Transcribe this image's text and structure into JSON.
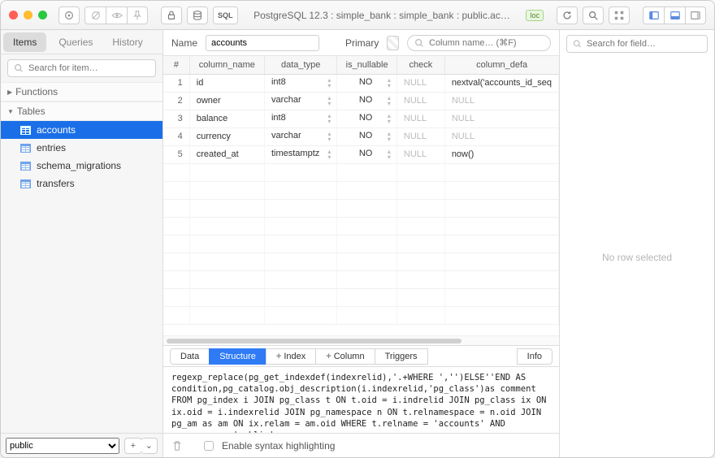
{
  "toolbar": {
    "sql_label": "SQL",
    "title": "PostgreSQL 12.3 : simple_bank : simple_bank : public.ac…",
    "loc_badge": "loc"
  },
  "sidebar": {
    "tabs": [
      "Items",
      "Queries",
      "History"
    ],
    "active_tab": 0,
    "search_placeholder": "Search for item…",
    "groups": [
      {
        "label": "Functions",
        "expanded": false
      },
      {
        "label": "Tables",
        "expanded": true
      }
    ],
    "tables": [
      "accounts",
      "entries",
      "schema_migrations",
      "transfers"
    ],
    "selected_table": "accounts",
    "schema_selector": "public"
  },
  "main": {
    "name_label": "Name",
    "name_value": "accounts",
    "primary_label": "Primary",
    "column_search_placeholder": "Column name… (⌘F)",
    "headers": [
      "#",
      "column_name",
      "data_type",
      "is_nullable",
      "check",
      "column_defa"
    ],
    "rows": [
      {
        "n": 1,
        "name": "id",
        "type": "int8",
        "nullable": "NO",
        "check": "NULL",
        "default": "nextval('accounts_id_seq"
      },
      {
        "n": 2,
        "name": "owner",
        "type": "varchar",
        "nullable": "NO",
        "check": "NULL",
        "default": "NULL"
      },
      {
        "n": 3,
        "name": "balance",
        "type": "int8",
        "nullable": "NO",
        "check": "NULL",
        "default": "NULL"
      },
      {
        "n": 4,
        "name": "currency",
        "type": "varchar",
        "nullable": "NO",
        "check": "NULL",
        "default": "NULL"
      },
      {
        "n": 5,
        "name": "created_at",
        "type": "timestamptz",
        "nullable": "NO",
        "check": "NULL",
        "default": "now()"
      }
    ],
    "tabs": [
      "Data",
      "Structure",
      "Index",
      "Column",
      "Triggers",
      "Info"
    ],
    "tab_plus": [
      false,
      false,
      true,
      true,
      false,
      false
    ],
    "active_tab": 1,
    "sql": "regexp_replace(pg_get_indexdef(indexrelid),'.+WHERE ','')ELSE''END AS condition,pg_catalog.obj_description(i.indexrelid,'pg_class')as comment FROM pg_index i JOIN pg_class t ON t.oid = i.indrelid JOIN pg_class ix ON ix.oid = i.indexrelid JOIN pg_namespace n ON t.relnamespace = n.oid JOIN pg_am as am ON ix.relam = am.oid WHERE t.relname = 'accounts' AND n.nspname = 'public';",
    "footer": {
      "syntax_label": "Enable syntax highlighting"
    }
  },
  "inspector": {
    "search_placeholder": "Search for field…",
    "empty": "No row selected"
  }
}
